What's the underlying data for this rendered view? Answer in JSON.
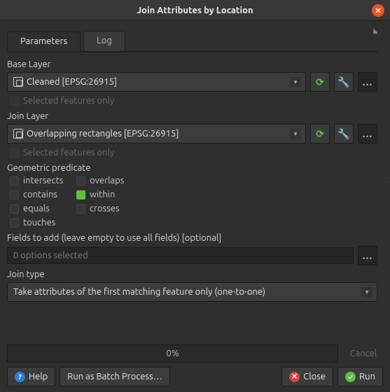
{
  "window": {
    "title": "Join Attributes by Location"
  },
  "tabs": {
    "parameters": "Parameters",
    "log": "Log"
  },
  "base": {
    "label": "Base Layer",
    "value": "Cleaned [EPSG:26915]",
    "selected_only": "Selected features only"
  },
  "join": {
    "label": "Join Layer",
    "value": "Overlapping rectangles [EPSG:26915]",
    "selected_only": "Selected features only"
  },
  "predicate": {
    "label": "Geometric predicate",
    "intersects": "intersects",
    "overlaps": "overlaps",
    "contains": "contains",
    "within": "within",
    "equals": "equals",
    "crosses": "crosses",
    "touches": "touches"
  },
  "fields": {
    "label": "Fields to add (leave empty to use all fields) [optional]",
    "value": "0 options selected"
  },
  "jointype": {
    "label": "Join type",
    "value": "Take attributes of the first matching feature only (one-to-one)"
  },
  "progress": {
    "pct": "0%",
    "cancel": "Cancel"
  },
  "buttons": {
    "help": "Help",
    "batch": "Run as Batch Process…",
    "close": "Close",
    "run": "Run"
  }
}
